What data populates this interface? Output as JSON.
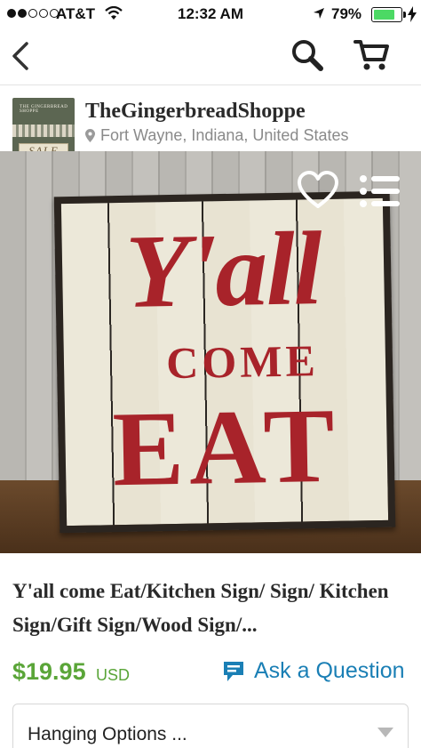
{
  "status_bar": {
    "carrier": "AT&T",
    "time": "12:32 AM",
    "battery_percent": "79%",
    "battery_level": 0.79,
    "signal_bars_filled": 2,
    "signal_bars_total": 5,
    "battery_color": "#4cd964"
  },
  "nav": {
    "back_icon": "chevron-left",
    "search_icon": "search",
    "cart_icon": "shopping-cart"
  },
  "shop": {
    "name": "TheGingerbreadShoppe",
    "location": "Fort Wayne, Indiana, United States",
    "avatar_title": "THE GINGERBREAD SHOPPE",
    "avatar_sale": "SALE"
  },
  "listing_image": {
    "sign_line1": "Y'all",
    "sign_line2": "COME",
    "sign_line3": "EAT",
    "favorite_icon": "heart-outline",
    "menu_icon": "list"
  },
  "listing": {
    "title": "Y'all come Eat/Kitchen Sign/ Sign/ Kitchen Sign/Gift Sign/Wood Sign/...",
    "price": "$19.95",
    "currency": "USD",
    "price_color": "#5aa538",
    "ask_label": "Ask a Question",
    "ask_color": "#1a7fb5",
    "options_label": "Hanging Options ..."
  }
}
